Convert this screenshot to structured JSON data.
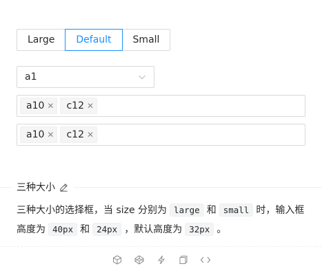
{
  "size_switch": {
    "options": [
      "Large",
      "Default",
      "Small"
    ],
    "selected": "Default"
  },
  "single_select": {
    "value": "a1"
  },
  "multi_select_1": {
    "tags": [
      "a10",
      "c12"
    ]
  },
  "multi_select_2": {
    "tags": [
      "a10",
      "c12"
    ]
  },
  "section": {
    "title": "三种大小"
  },
  "description": {
    "p1": "三种大小的选择框，当 size 分别为",
    "c1": "large",
    "p2": "和",
    "c2": "small",
    "p3": "时，输入框高度为",
    "c3": "40px",
    "p4": "和",
    "c4": "24px",
    "p5": "，默认高度为",
    "c5": "32px",
    "p6": "。"
  },
  "colors": {
    "primary": "#1890ff",
    "border": "#d9d9d9"
  },
  "action_icons": [
    "codesandbox-icon",
    "codepen-icon",
    "thunderbolt-icon",
    "copy-icon",
    "code-icon"
  ]
}
